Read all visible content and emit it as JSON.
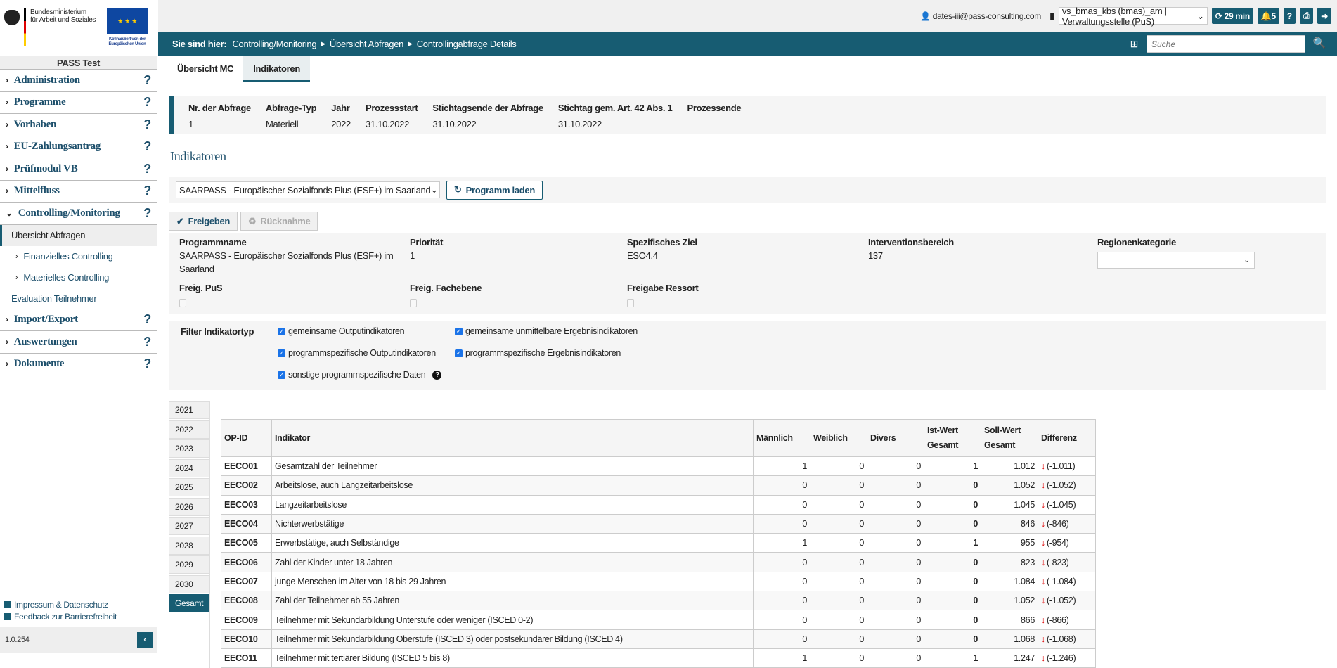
{
  "logo": {
    "ministry": [
      "Bundesministerium",
      "für Arbeit und Soziales"
    ],
    "eu": [
      "Kofinanziert von der",
      "Europäischen Union"
    ]
  },
  "sidebar": {
    "env": "PASS Test",
    "items_top": [
      {
        "label": "Administration"
      },
      {
        "label": "Programme"
      },
      {
        "label": "Vorhaben"
      },
      {
        "label": "EU-Zahlungsantrag"
      },
      {
        "label": "Prüfmodul VB"
      },
      {
        "label": "Mittelfluss"
      }
    ],
    "controlling": {
      "label": "Controlling/Monitoring",
      "subs": [
        "Übersicht Abfragen",
        "Finanzielles Controlling",
        "Materielles Controlling",
        "Evaluation Teilnehmer"
      ]
    },
    "items_bottom": [
      {
        "label": "Import/Export"
      },
      {
        "label": "Auswertungen"
      },
      {
        "label": "Dokumente"
      }
    ],
    "help": "?",
    "footer": {
      "impressum": "Impressum & Datenschutz",
      "feedback": "Feedback zur Barrierefreiheit",
      "version": "1.0.254"
    }
  },
  "topbar": {
    "user": "dates-iii@pass-consulting.com",
    "role": "vs_bmas_kbs (bmas)_am | Verwaltungsstelle (PuS)",
    "session": "29 min",
    "notifications": "5",
    "help": "?"
  },
  "navbar": {
    "label": "Sie sind hier:",
    "crumbs": [
      "Controlling/Monitoring",
      "Übersicht Abfragen",
      "Controllingabfrage Details"
    ],
    "search_placeholder": "Suche"
  },
  "tabs": [
    "Übersicht MC",
    "Indikatoren"
  ],
  "info": {
    "headers": [
      "Nr. der Abfrage",
      "Abfrage-Typ",
      "Jahr",
      "Prozessstart",
      "Stichtagsende der Abfrage",
      "Stichtag gem. Art. 42 Abs. 1",
      "Prozessende"
    ],
    "values": [
      "1",
      "Materiell",
      "2022",
      "31.10.2022",
      "31.10.2022",
      "31.10.2022",
      ""
    ]
  },
  "section_title": "Indikatoren",
  "program": {
    "selected": "SAARPASS - Europäischer Sozialfonds Plus (ESF+) im Saarland",
    "load": "Programm laden"
  },
  "actions": {
    "release": "Freigeben",
    "revoke": "Rücknahme"
  },
  "pinfo": {
    "name_h": "Programmname",
    "name": "SAARPASS - Europäischer Sozialfonds Plus (ESF+) im Saarland",
    "prio_h": "Priorität",
    "prio": "1",
    "ziel_h": "Spezifisches Ziel",
    "ziel": "ESO4.4",
    "ib_h": "Interventionsbereich",
    "ib": "137",
    "rk_h": "Regionenkategorie",
    "fpus": "Freig. PuS",
    "ffach": "Freig. Fachebene",
    "fres": "Freigabe Ressort"
  },
  "filter": {
    "label": "Filter Indikatortyp",
    "options": [
      "gemeinsame Outputindikatoren",
      "gemeinsame unmittelbare Ergebnisindikatoren",
      "programmspezifische Outputindikatoren",
      "programmspezifische Ergebnisindikatoren",
      "sonstige programmspezifische Daten"
    ]
  },
  "years": [
    "2021",
    "2022",
    "2023",
    "2024",
    "2025",
    "2026",
    "2027",
    "2028",
    "2029",
    "2030",
    "Gesamt"
  ],
  "table": {
    "headers": [
      "OP-ID",
      "Indikator",
      "Männlich",
      "Weiblich",
      "Divers",
      "Ist-Wert Gesamt",
      "Soll-Wert Gesamt",
      "Differenz"
    ],
    "rows": [
      [
        "EECO01",
        "Gesamtzahl der Teilnehmer",
        "1",
        "0",
        "0",
        "1",
        "1.012",
        "(-1.011)"
      ],
      [
        "EECO02",
        "Arbeitslose, auch Langzeitarbeitslose",
        "0",
        "0",
        "0",
        "0",
        "1.052",
        "(-1.052)"
      ],
      [
        "EECO03",
        "Langzeitarbeitslose",
        "0",
        "0",
        "0",
        "0",
        "1.045",
        "(-1.045)"
      ],
      [
        "EECO04",
        "Nichterwerbstätige",
        "0",
        "0",
        "0",
        "0",
        "846",
        "(-846)"
      ],
      [
        "EECO05",
        "Erwerbstätige, auch Selbständige",
        "1",
        "0",
        "0",
        "1",
        "955",
        "(-954)"
      ],
      [
        "EECO06",
        "Zahl der Kinder unter 18 Jahren",
        "0",
        "0",
        "0",
        "0",
        "823",
        "(-823)"
      ],
      [
        "EECO07",
        "junge Menschen im Alter von 18 bis 29 Jahren",
        "0",
        "0",
        "0",
        "0",
        "1.084",
        "(-1.084)"
      ],
      [
        "EECO08",
        "Zahl der Teilnehmer ab 55 Jahren",
        "0",
        "0",
        "0",
        "0",
        "1.052",
        "(-1.052)"
      ],
      [
        "EECO09",
        "Teilnehmer mit Sekundarbildung Unterstufe oder weniger (ISCED 0-2)",
        "0",
        "0",
        "0",
        "0",
        "866",
        "(-866)"
      ],
      [
        "EECO10",
        "Teilnehmer mit Sekundarbildung Oberstufe (ISCED 3) oder postsekundärer Bildung (ISCED 4)",
        "0",
        "0",
        "0",
        "0",
        "1.068",
        "(-1.068)"
      ],
      [
        "EECO11",
        "Teilnehmer mit tertiärer Bildung (ISCED 5 bis 8)",
        "1",
        "0",
        "0",
        "1",
        "1.247",
        "(-1.246)"
      ]
    ]
  },
  "colors": {
    "primary": "#175c72",
    "accent_red": "#dd0000"
  }
}
